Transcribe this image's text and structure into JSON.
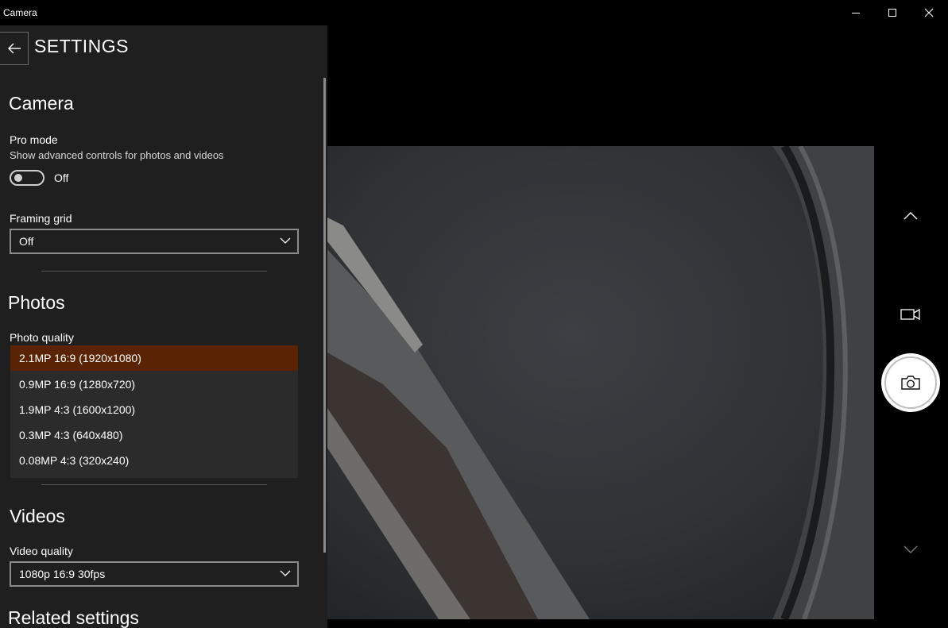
{
  "window": {
    "title": "Camera"
  },
  "settings": {
    "title": "SETTINGS",
    "camera_section": {
      "heading": "Camera",
      "pro_mode": {
        "label": "Pro mode",
        "description": "Show advanced controls for photos and videos",
        "state": "Off"
      },
      "framing_grid": {
        "label": "Framing grid",
        "value": "Off"
      }
    },
    "photos_section": {
      "heading": "Photos",
      "photo_quality": {
        "label": "Photo quality",
        "options": [
          "2.1MP 16:9 (1920x1080)",
          "0.9MP 16:9 (1280x720)",
          "1.9MP 4:3 (1600x1200)",
          "0.3MP 4:3 (640x480)",
          "0.08MP 4:3 (320x240)"
        ],
        "selected_index": 0
      }
    },
    "videos_section": {
      "heading": "Videos",
      "video_quality": {
        "label": "Video quality",
        "value": "1080p 16:9 30fps"
      }
    },
    "related_section": {
      "heading": "Related settings"
    }
  },
  "icons": {
    "back": "arrow-left-icon",
    "minimize": "minimize-icon",
    "maximize": "maximize-icon",
    "close": "close-icon",
    "chevron_up": "chevron-up-icon",
    "video": "video-camera-icon",
    "photo": "camera-icon",
    "chevron_down": "chevron-down-icon"
  },
  "colors": {
    "accent_selected": "#5a2404",
    "panel_bg": "#1f1f1f",
    "dropdown_bg": "#2b2b2b"
  }
}
